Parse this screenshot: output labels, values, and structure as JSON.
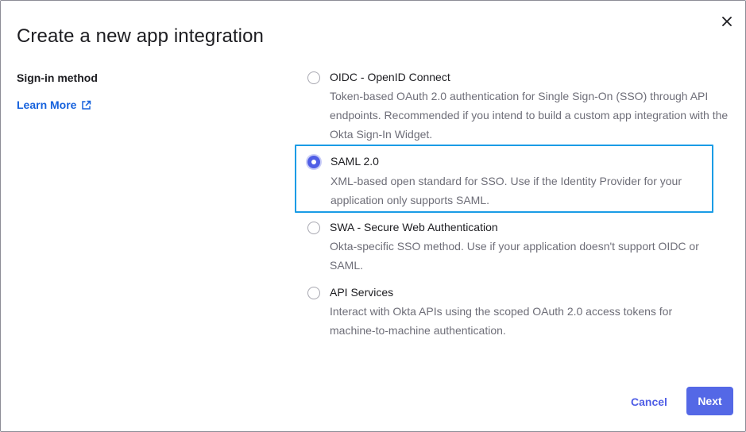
{
  "dialog": {
    "title": "Create a new app integration"
  },
  "sidebar": {
    "label": "Sign-in method",
    "learn_more": "Learn More"
  },
  "options": [
    {
      "title": "OIDC - OpenID Connect",
      "description": "Token-based OAuth 2.0 authentication for Single Sign-On (SSO) through API endpoints. Recommended if you intend to build a custom app integration with the Okta Sign-In Widget.",
      "selected": false
    },
    {
      "title": "SAML 2.0",
      "description": "XML-based open standard for SSO. Use if the Identity Provider for your application only supports SAML.",
      "selected": true
    },
    {
      "title": "SWA - Secure Web Authentication",
      "description": "Okta-specific SSO method. Use if your application doesn't support OIDC or SAML.",
      "selected": false
    },
    {
      "title": "API Services",
      "description": "Interact with Okta APIs using the scoped OAuth 2.0 access tokens for machine-to-machine authentication.",
      "selected": false
    }
  ],
  "footer": {
    "cancel_label": "Cancel",
    "next_label": "Next"
  },
  "colors": {
    "accent": "#4f5ee6",
    "link": "#1662dd",
    "selection_border": "#1a9ce6"
  },
  "icons": {
    "close": "close-icon",
    "external_link": "external-link-icon"
  }
}
